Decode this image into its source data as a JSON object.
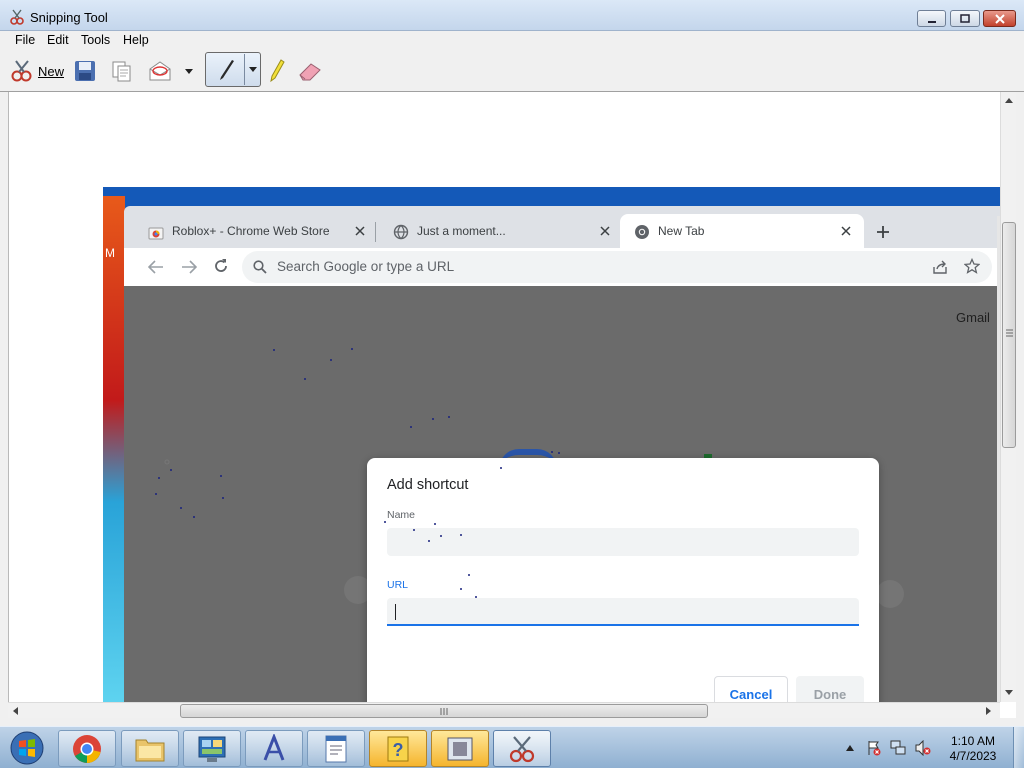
{
  "window": {
    "title": "Snipping Tool"
  },
  "menu": [
    "File",
    "Edit",
    "Tools",
    "Help"
  ],
  "toolbar": {
    "new_label": "New"
  },
  "chrome": {
    "tabs": [
      {
        "title": "Roblox+ - Chrome Web Store"
      },
      {
        "title": "Just a moment..."
      },
      {
        "title": "New Tab"
      }
    ],
    "omnibox_placeholder": "Search Google or type a URL",
    "gmail_link": "Gmail",
    "partial_left_text": "M"
  },
  "dialog": {
    "title": "Add shortcut",
    "name_label": "Name",
    "name_value": "",
    "url_label": "URL",
    "url_value": "",
    "cancel_label": "Cancel",
    "done_label": "Done"
  },
  "taskbar": {
    "clock_time": "1:10 AM",
    "clock_date": "4/7/2023"
  },
  "colors": {
    "accent_blue": "#1a73e8",
    "titlebar": "#c4d6ec",
    "chrome_dark_overlay": "#6b6b6b",
    "taskbar": "#a9c3de"
  }
}
